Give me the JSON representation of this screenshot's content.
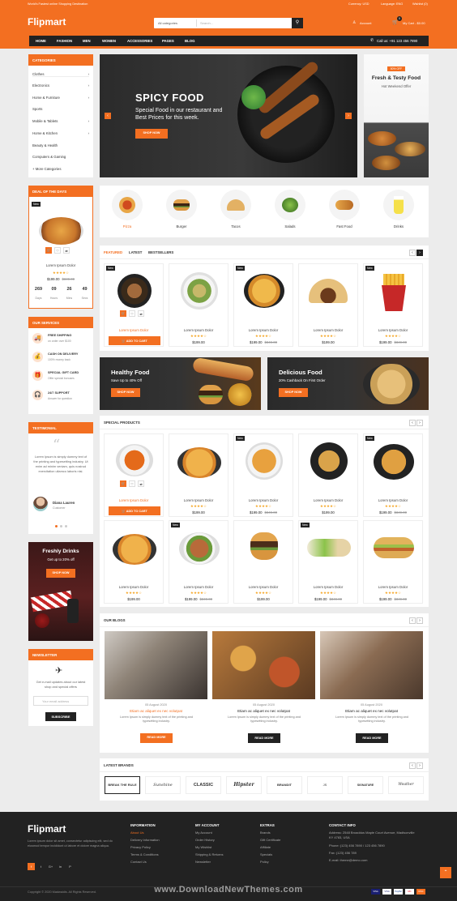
{
  "header": {
    "tagline": "World's Fastest online Shopping Destination",
    "currency": "Currency: USD",
    "language": "Language: ENG",
    "wishlist": "Wishlist (0)",
    "logo": "Flipmart",
    "search_category": "All categories",
    "search_placeholder": "Search...",
    "account": "Account",
    "cart": "My Cart - $0.00",
    "cart_count": "0",
    "phone": "Call us: +91 123 456 7890"
  },
  "nav": [
    "HOME",
    "FASHION",
    "MEN",
    "WOMEN",
    "ACCESSORIES",
    "PAGES",
    "BLOG"
  ],
  "categories": {
    "title": "CATEGORIES",
    "items": [
      "Clothes",
      "Electronics",
      "Home & Furniture",
      "Sports",
      "Mobile & Tablets",
      "Home & Kitchen",
      "Beauty & Health",
      "Computers & Gaming"
    ],
    "more": "More Categories"
  },
  "deal": {
    "title": "DEAL OF THE DAYS",
    "badge": "New",
    "name": "Lorem Ipsum Dolor",
    "price": "$199.00",
    "old": "$349.00",
    "counts": [
      "269",
      "09",
      "26",
      "49"
    ],
    "units": [
      "Days",
      "Hours",
      "Mins",
      "Secs"
    ]
  },
  "services": {
    "title": "OUR SERVICES",
    "items": [
      {
        "t": "FREE SHIPPING",
        "s": "on order over $100"
      },
      {
        "t": "CASH ON DELIVERY",
        "s": "100% money back"
      },
      {
        "t": "SPECIAL GIFT CARD",
        "s": "Offer special bonuses"
      },
      {
        "t": "24/7 SUPPORT",
        "s": "Answer for question"
      }
    ]
  },
  "testimonial": {
    "title": "TESTIMONIAL",
    "text": "Lorem Ipsum is simply dummy text of the printing and typesetting industry. Ut enim ad minim veniam, quis nostrud exercitation ullamco laboris nisi.",
    "name": "Diana Lauren",
    "role": "Customer"
  },
  "promo": {
    "title": "Freshly Drinks",
    "sub": "Get up to 20% off",
    "btn": "SHOP NOW"
  },
  "newsletter": {
    "title": "NEWSLETTER",
    "text": "Get e-mail updates about our latest shop and special offers",
    "placeholder": "Your email address",
    "btn": "SUBSCRIBE"
  },
  "hero": {
    "title": "SPICY FOOD",
    "sub": "Special Food in our restaurant and Best Prices for this week.",
    "btn": "SHOP NOW"
  },
  "side_banner": {
    "tag": "50% OFF",
    "title": "Fresh & Testy Food",
    "sub": "Hot Weekend Offer"
  },
  "food_cats": [
    "Pizza",
    "Burger",
    "Tacos",
    "Salads",
    "Fast Food",
    "Drinks"
  ],
  "featured": {
    "tabs": [
      "FEATURED",
      "LATEST",
      "BESTSELLERS"
    ],
    "items": [
      {
        "badge": "New",
        "name": "Lorem Ipsum Dolor",
        "price": "",
        "old": "",
        "cart": "ADD TO CART"
      },
      {
        "badge": "",
        "name": "Lorem Ipsum Dolor",
        "price": "$199.00",
        "old": ""
      },
      {
        "badge": "New",
        "name": "Lorem Ipsum Dolor",
        "price": "$199.00",
        "old": "$349.00"
      },
      {
        "badge": "",
        "name": "Lorem Ipsum Dolor",
        "price": "$199.00",
        "old": ""
      },
      {
        "badge": "New",
        "name": "Lorem Ipsum Dolor",
        "price": "$199.00",
        "old": "$349.00"
      }
    ]
  },
  "banners": [
    {
      "title": "Healthy Food",
      "sub": "Save Up to 40% Off",
      "btn": "SHOP NOW"
    },
    {
      "title": "Delicious Food",
      "sub": "20% Cashback On First Order",
      "btn": "SHOP NOW"
    }
  ],
  "special": {
    "title": "SPECIAL PRODUCTS",
    "items": [
      {
        "badge": "",
        "name": "Lorem Ipsum Dolor",
        "price": "",
        "old": "",
        "cart": "ADD TO CART"
      },
      {
        "badge": "",
        "name": "Lorem Ipsum Dolor",
        "price": "$199.00",
        "old": ""
      },
      {
        "badge": "New",
        "name": "Lorem Ipsum Dolor",
        "price": "$199.00",
        "old": "$349.00"
      },
      {
        "badge": "",
        "name": "Lorem Ipsum Dolor",
        "price": "$199.00",
        "old": ""
      },
      {
        "badge": "New",
        "name": "Lorem Ipsum Dolor",
        "price": "$199.00",
        "old": "$349.00"
      },
      {
        "badge": "",
        "name": "Lorem Ipsum Dolor",
        "price": "$199.00",
        "old": ""
      },
      {
        "badge": "New",
        "name": "Lorem Ipsum Dolor",
        "price": "$199.00",
        "old": "$349.00"
      },
      {
        "badge": "",
        "name": "Lorem Ipsum Dolor",
        "price": "$199.00",
        "old": ""
      },
      {
        "badge": "New",
        "name": "Lorem Ipsum Dolor",
        "price": "$199.00",
        "old": "$349.00"
      },
      {
        "badge": "",
        "name": "Lorem Ipsum Dolor",
        "price": "$199.00",
        "old": "$349.00"
      }
    ]
  },
  "blogs": {
    "title": "OUR BLOGS",
    "items": [
      {
        "date": "05 August 2020",
        "title": "Etiam ac aliquet ex nec volutpat",
        "text": "Lorem Ipsum is simply dummy text of the printing and typesetting industry.",
        "btn": "READ MORE"
      },
      {
        "date": "05 August 2020",
        "title": "Etiam ac aliquet ex nec volutpat",
        "text": "Lorem Ipsum is simply dummy text of the printing and typesetting industry.",
        "btn": "READ MORE"
      },
      {
        "date": "05 August 2020",
        "title": "Etiam ac aliquet ex nec volutpat",
        "text": "Lorem Ipsum is simply dummy text of the printing and typesetting industry.",
        "btn": "READ MORE"
      }
    ]
  },
  "brands": {
    "title": "LATEST BRANDS",
    "items": [
      "BREAK THE RULE",
      "Sunshine",
      "CLASSIC",
      "Hipster",
      "BRANDIT",
      "JS",
      "SIGNATURE",
      "Weather"
    ]
  },
  "footer": {
    "logo": "Flipmart",
    "about": "Lorem ipsum dolor sit amet, consectetur adipiscing elit, sed do eiusmod tempor incididunt ut labore et dolore magna aliqua.",
    "social": [
      "f",
      "t",
      "G+",
      "in",
      "P"
    ],
    "cols": [
      {
        "title": "INFORMATION",
        "items": [
          "About Us",
          "Delivery Information",
          "Privacy Policy",
          "Terms & Conditions",
          "Contact Us"
        ]
      },
      {
        "title": "MY ACCOUNT",
        "items": [
          "My Account",
          "Order History",
          "My Wishlist",
          "Shipping & Returns",
          "Newsletter"
        ]
      },
      {
        "title": "EXTRAS",
        "items": [
          "Brands",
          "Gift Certificate",
          "Affiliate",
          "Specials",
          "Policy"
        ]
      }
    ],
    "contact": {
      "title": "CONTACT INFO",
      "address": "Address: 2548 Broaddus Maple Court Avenue, Madisonville KY 4783, USA",
      "phone": "Phone: (123) 456 7890 / 123 456 7890",
      "fax": "Fax: (123) 456 789",
      "email": "E-mail: theme@demo.com"
    },
    "copyright": "Copyright © 2020 Madwaidis. All Rights Reserved.",
    "payments": [
      "VISA",
      "VISA",
      "PayPal",
      "MC",
      "DISC"
    ]
  },
  "watermark": "www.DownloadNewThemes.com",
  "colors": {
    "accent": "#f36f21",
    "dark": "#222222"
  }
}
